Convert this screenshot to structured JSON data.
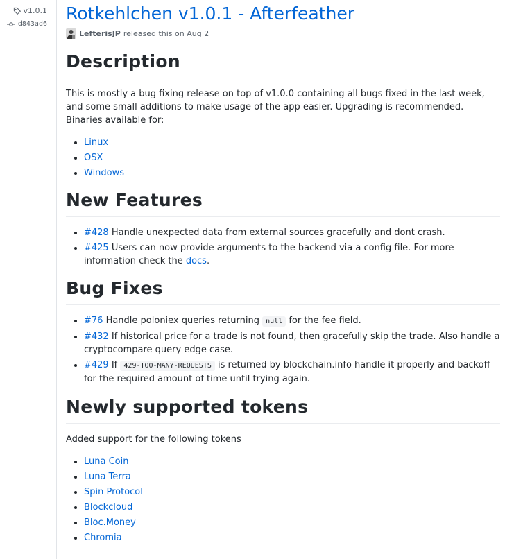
{
  "sidebar": {
    "tag": "v1.0.1",
    "commit": "d843ad6"
  },
  "release": {
    "title": "Rotkehlchen v1.0.1 - Afterfeather",
    "author": "LefterisJP",
    "released_text": "released this on Aug 2"
  },
  "description": {
    "heading": "Description",
    "text": "This is mostly a bug fixing release on top of v1.0.0 containing all bugs fixed in the last week, and some small additions to make usage of the app easier. Upgrading is recommended. Binaries available for:",
    "platforms": [
      "Linux",
      "OSX",
      "Windows"
    ]
  },
  "features": {
    "heading": "New Features",
    "items": [
      {
        "issue": "#428",
        "text": " Handle unexpected data from external sources gracefully and dont crash."
      },
      {
        "issue": "#425",
        "text": " Users can now provide arguments to the backend via a config file. For more information check the ",
        "link": "docs",
        "after": "."
      }
    ]
  },
  "bugfixes": {
    "heading": "Bug Fixes",
    "items": [
      {
        "issue": "#76",
        "before": " Handle poloniex queries returning ",
        "code": "null",
        "after": " for the fee field."
      },
      {
        "issue": "#432",
        "text": " If historical price for a trade is not found, then gracefully skip the trade. Also handle a cryptocompare query edge case."
      },
      {
        "issue": "#429",
        "before": " If ",
        "code": "429-TOO-MANY-REQUESTS",
        "after": " is returned by blockchain.info handle it properly and backoff for the required amount of time until trying again."
      }
    ]
  },
  "tokens": {
    "heading": "Newly supported tokens",
    "text": "Added support for the following tokens",
    "items": [
      "Luna Coin",
      "Luna Terra",
      "Spin Protocol",
      "Blockcloud",
      "Bloc.Money",
      "Chromia"
    ]
  }
}
